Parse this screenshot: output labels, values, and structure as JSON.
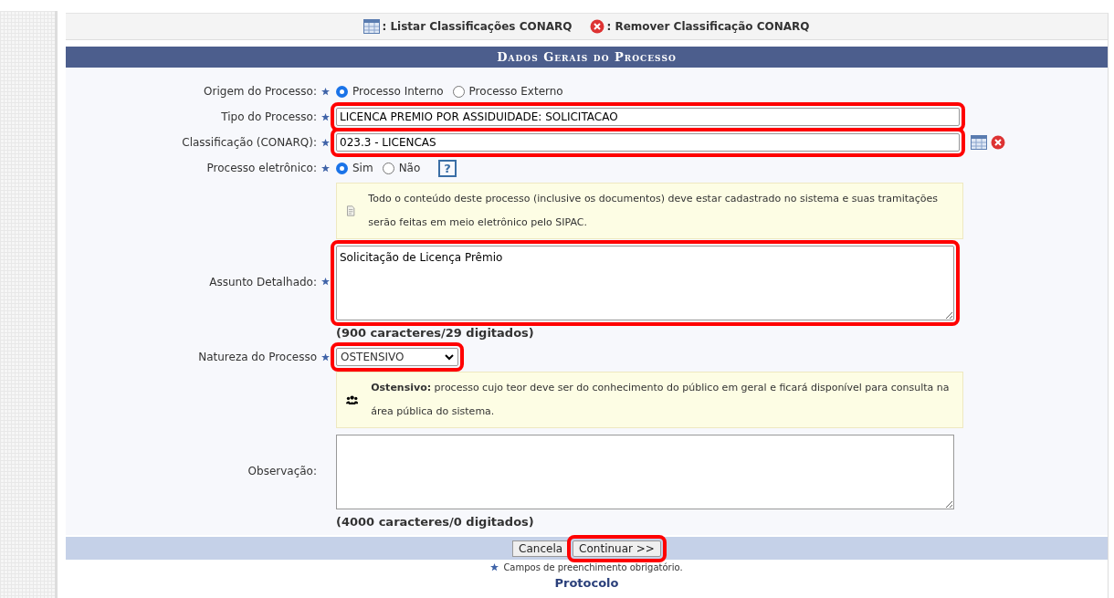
{
  "legend": [
    {
      "kind": "list",
      "label": ": Listar Classificações CONARQ"
    },
    {
      "kind": "remove",
      "label": ": Remover Classificação CONARQ"
    }
  ],
  "section_title": "Dados Gerais do Processo",
  "fields": [
    {
      "kind": "radio",
      "label": "Origem do Processo:",
      "required": true,
      "options": [
        {
          "label": "Processo Interno",
          "selected": true
        },
        {
          "label": "Processo Externo",
          "selected": false
        }
      ]
    },
    {
      "kind": "text",
      "label": "Tipo do Processo:",
      "required": true,
      "value": "LICENCA PREMIO POR ASSIDUIDADE: SOLICITACAO",
      "highlighted": true
    },
    {
      "kind": "lookup",
      "label": "Classificação (CONARQ):",
      "required": true,
      "value": "023.3 - LICENCAS",
      "highlighted": true
    },
    {
      "kind": "radio",
      "label": "Processo eletrônico:",
      "required": true,
      "options": [
        {
          "label": "Sim",
          "selected": true
        },
        {
          "label": "Não",
          "selected": false
        }
      ],
      "help": "?",
      "note": "Todo o conteúdo deste processo (inclusive os documentos) deve estar cadastrado no sistema e suas tramitações serão feitas em meio eletrônico pelo SIPAC."
    },
    {
      "kind": "textarea",
      "label": "Assunto Detalhado:",
      "required": true,
      "value": "Solicitação de Licença Prêmio",
      "highlighted": true,
      "counter": "(900 caracteres/29 digitados)"
    },
    {
      "kind": "select",
      "label": "Natureza do Processo",
      "required": true,
      "value": "OSTENSIVO",
      "highlighted": true,
      "note": "**Ostensivo:** processo cujo teor deve ser do conhecimento do público em geral e ficará disponível para consulta na área pública do sistema."
    },
    {
      "kind": "textarea",
      "label": "Observação:",
      "required": false,
      "counter": "(4000 caracteres/0 digitados)"
    }
  ],
  "buttons": [
    {
      "label": "Cancela",
      "highlighted": false
    },
    {
      "label": "Continuar >>",
      "highlighted": true
    }
  ],
  "footnote": "Campos de preenchimento obrigatório.",
  "footer_link": "Protocolo"
}
